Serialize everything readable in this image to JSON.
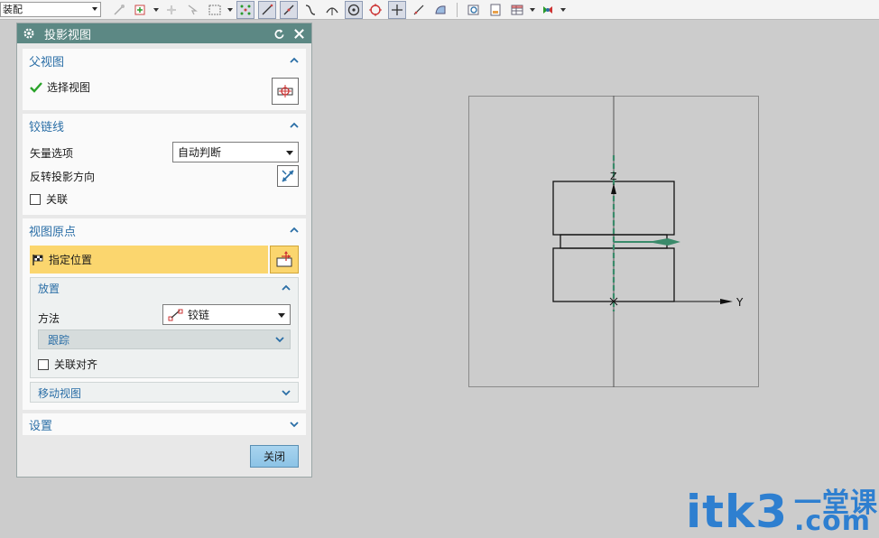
{
  "toolbar": {
    "mode_select": "装配",
    "icons": [
      "snap-endpoint-icon",
      "snap-point-icon",
      "snap-midpoint-icon",
      "rect-select-icon",
      "snap-grid-icon",
      "line-icon",
      "tangent-line-icon",
      "curve-icon",
      "arc-icon",
      "circle-center-icon",
      "quadrant-icon",
      "intersection-icon",
      "perpendicular-icon",
      "surface-icon",
      "view-fit-icon",
      "view-page-icon",
      "table-icon",
      "color-icon"
    ]
  },
  "dialog": {
    "title": "投影视图",
    "parent_view": {
      "header": "父视图",
      "select_label": "选择视图"
    },
    "hinge": {
      "header": "铰链线",
      "vector_label": "矢量选项",
      "vector_value": "自动判断",
      "reverse_label": "反转投影方向",
      "associate_label": "关联"
    },
    "origin": {
      "header": "视图原点",
      "specify_label": "指定位置",
      "placement": {
        "header": "放置",
        "method_label": "方法",
        "method_value": "铰链",
        "track_header": "跟踪",
        "align_label": "关联对齐"
      },
      "move_header": "移动视图"
    },
    "settings_header": "设置",
    "close_label": "关闭"
  },
  "drawing": {
    "axis_z": "Z",
    "axis_y": "Y",
    "accent": "#3a8a6a"
  },
  "watermark": {
    "main": "itk3",
    "cn": "一堂课",
    "dot": ".com"
  }
}
